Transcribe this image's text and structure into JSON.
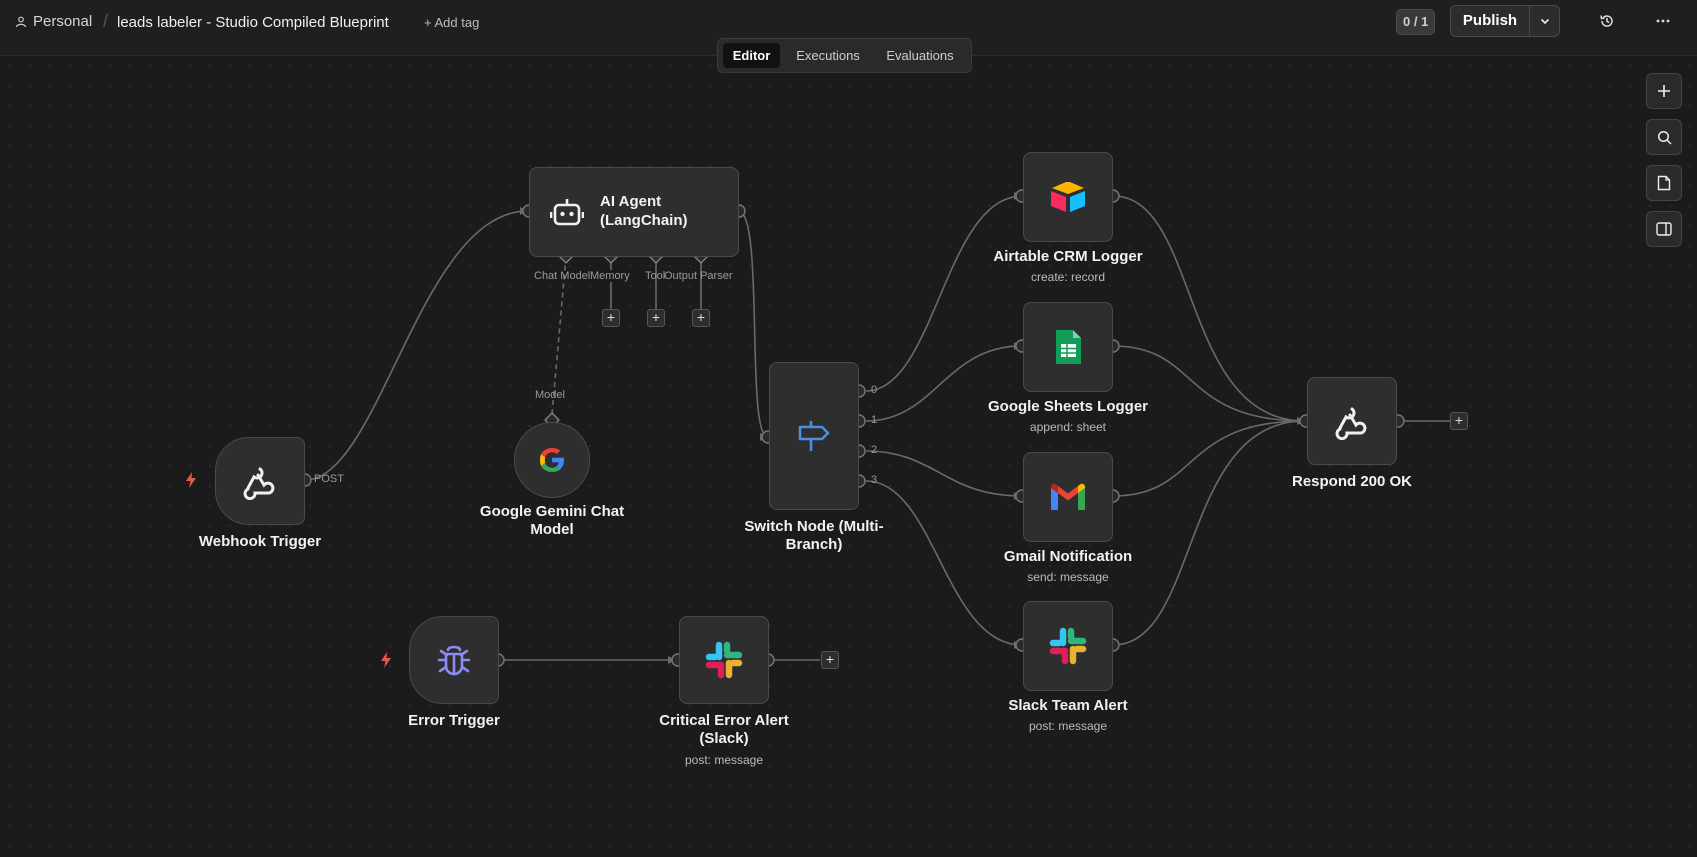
{
  "header": {
    "workspace": "Personal",
    "workflow_title": "leads labeler - Studio Compiled Blueprint",
    "add_tag": "+ Add tag",
    "counter": "0 / 1",
    "publish_label": "Publish"
  },
  "tabs": [
    "Editor",
    "Executions",
    "Evaluations"
  ],
  "active_tab": "Editor",
  "toolbar_icons": [
    "plus-icon",
    "search-icon",
    "sticky-note-icon",
    "panel-icon"
  ],
  "nodes": {
    "webhook": {
      "label": "Webhook Trigger",
      "output_label": "POST"
    },
    "agent": {
      "label": "AI Agent (LangChain)",
      "title_line1": "AI Agent",
      "title_line2": "(LangChain)",
      "handles": [
        "Chat Model",
        "Memory",
        "Tool",
        "Output Parser"
      ]
    },
    "gemini": {
      "label_line1": "Google Gemini Chat",
      "label_line2": "Model",
      "handle": "Model"
    },
    "switch": {
      "label_line1": "Switch Node (Multi-",
      "label_line2": "Branch)",
      "outputs": [
        "0",
        "1",
        "2",
        "3"
      ]
    },
    "airtable": {
      "label": "Airtable CRM Logger",
      "sub": "create: record"
    },
    "sheets": {
      "label": "Google Sheets Logger",
      "sub": "append: sheet"
    },
    "gmail": {
      "label": "Gmail Notification",
      "sub": "send: message"
    },
    "slack_team": {
      "label": "Slack Team Alert",
      "sub": "post: message"
    },
    "respond": {
      "label": "Respond 200 OK"
    },
    "error_trigger": {
      "label": "Error Trigger"
    },
    "critical_alert": {
      "label_line1": "Critical Error Alert",
      "label_line2": "(Slack)",
      "sub": "post: message"
    }
  },
  "colors": {
    "canvas": "#1b1b1b",
    "node_bg": "#2e2e2e",
    "edge": "#6a6a6a",
    "trigger_bolt": "#e8574a",
    "bug": "#8b8cf0",
    "switch_icon": "#4a90e2"
  }
}
